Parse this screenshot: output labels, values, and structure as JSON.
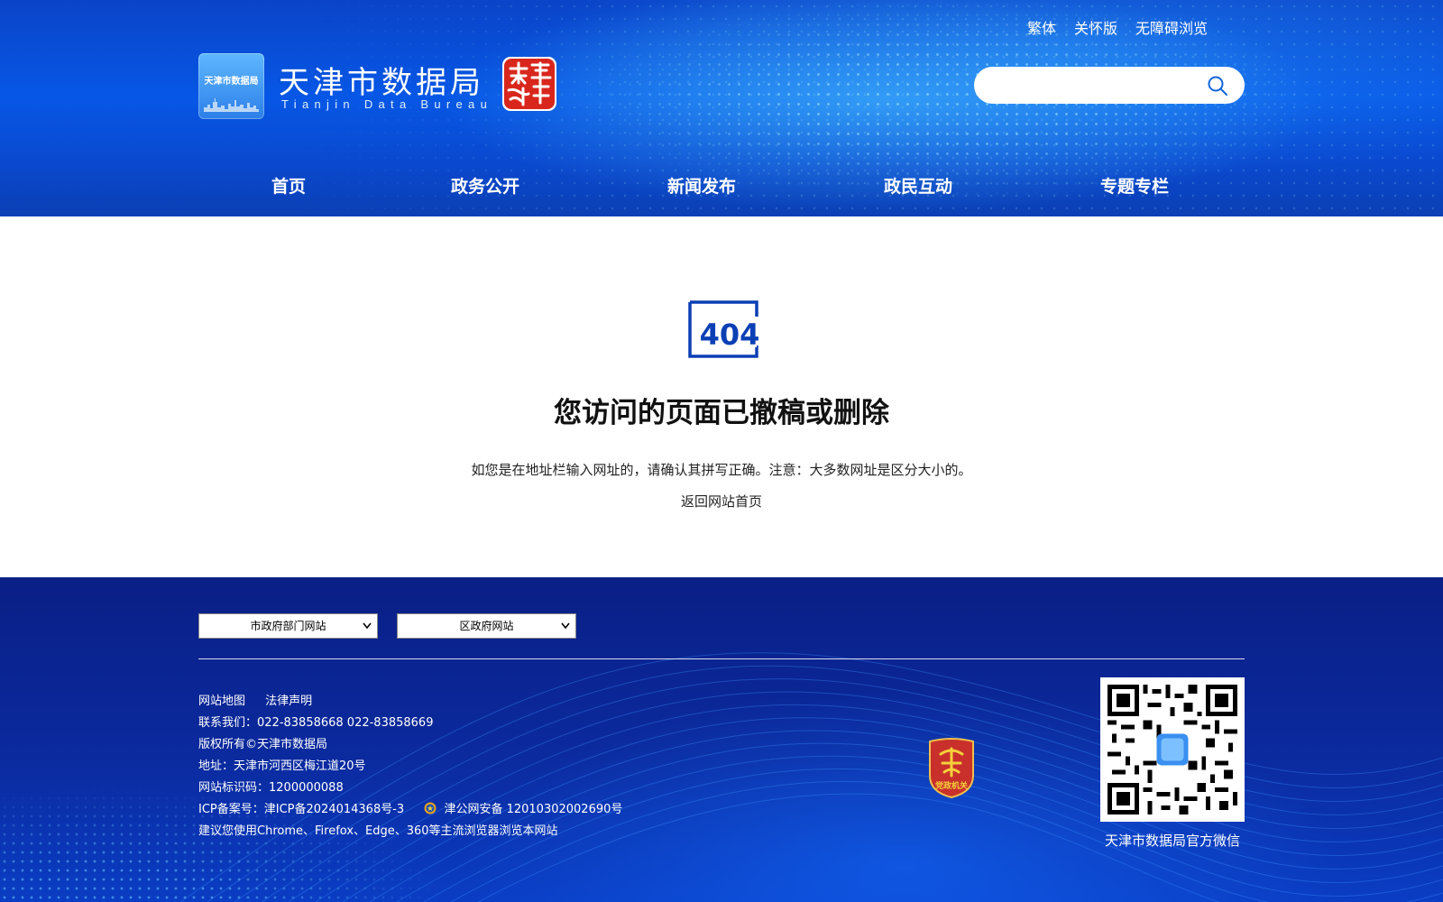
{
  "header": {
    "top_links": [
      "繁体",
      "关怀版",
      "无障碍浏览"
    ],
    "logo_text": "天津市数据局",
    "site_title": "天津市数据局",
    "site_subtitle": "Tianjin Data Bureau",
    "seal_text": "天津",
    "seal_color": "#d9261c",
    "search": {
      "placeholder": "",
      "icon": "search-icon"
    },
    "nav": [
      "首页",
      "政务公开",
      "新闻发布",
      "政民互动",
      "专题专栏"
    ]
  },
  "error": {
    "code": "404",
    "accent_color": "#0b3fb4",
    "title": "您访问的页面已撤稿或删除",
    "description": "如您是在地址栏输入网址的，请确认其拼写正确。注意：大多数网址是区分大小的。",
    "home_link": "返回网站首页"
  },
  "footer": {
    "selects": [
      "市政府部门网站",
      "区政府网站"
    ],
    "links": [
      "网站地图",
      "法律声明"
    ],
    "contact": "联系我们：022-83858668 022-83858669",
    "copyright": "版权所有©天津市数据局",
    "address": "地址：天津市河西区梅江道20号",
    "site_id": "网站标识码：1200000088",
    "icp": "ICP备案号：津ICP备2024014368号-3",
    "police": "津公网安备 12010302002690号",
    "browser_note": "建议您使用Chrome、Firefox、Edge、360等主流浏览器浏览本网站",
    "party_badge_text": "党政机关",
    "qr_caption": "天津市数据局官方微信"
  }
}
